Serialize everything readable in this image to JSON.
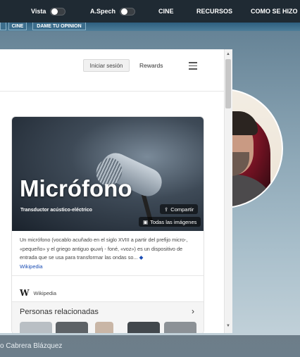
{
  "topbar": {
    "vista_label": "Vista",
    "aspeech_label": "A.Spech",
    "cine": "CINE",
    "recursos": "RECURSOS",
    "como_se_hizo": "COMO SE HIZO"
  },
  "subbar": {
    "cine": "CINE",
    "opinion": "DAME TU OPINION"
  },
  "browser": {
    "signin": "Iniciar sesión",
    "rewards": "Rewards",
    "card": {
      "title": "Micrófono",
      "subtitle": "Transductor acústico-eléctrico",
      "share": "Compartir",
      "all_images": "Todas las imágenes",
      "description": "Un micrófono (vocablo acuñado en el siglo XVIII a partir del prefijo micro-, «pequeño» y el griego antiguo φωνή - foné, «voz») es un dispositivo de entrada que se usa para transformar las ondas so...",
      "more_icon": "◆",
      "source_link": "Wikipedia",
      "wiki_source": "Wikipedia",
      "related_title": "Personas relacionadas"
    }
  },
  "footer": {
    "name": "o Cabrera Blázquez"
  }
}
